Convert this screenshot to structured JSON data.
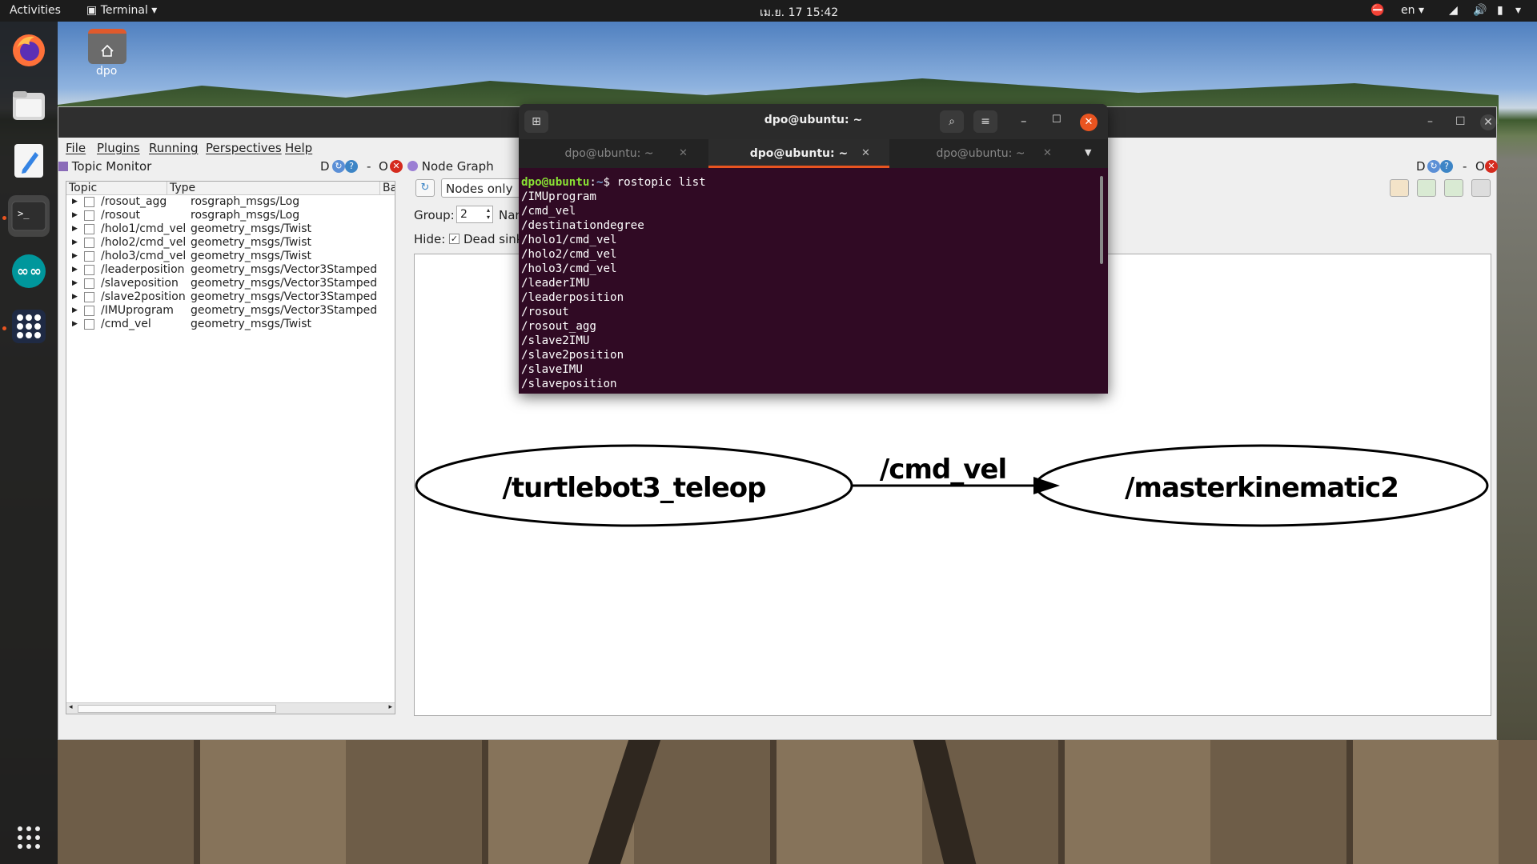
{
  "topbar": {
    "activities": "Activities",
    "app": "Terminal",
    "clock": "เม.ย. 17  15:42",
    "lang": "en"
  },
  "dock": {
    "icons": [
      "firefox-icon",
      "files-icon",
      "text-editor-icon",
      "terminal-icon",
      "arduino-icon",
      "app-grid-icon",
      "show-apps-icon"
    ]
  },
  "desktop": {
    "home_label": "dpo"
  },
  "rqt": {
    "menu": {
      "file": "File",
      "plugins": "Plugins",
      "running": "Running",
      "perspectives": "Perspectives",
      "help": "Help"
    },
    "topic_monitor": {
      "title": "Topic Monitor",
      "header_icons": [
        "D",
        "-",
        "O"
      ],
      "columns": [
        "Topic",
        "Type",
        "Ba"
      ],
      "rows": [
        {
          "topic": "/rosout_agg",
          "type": "rosgraph_msgs/Log"
        },
        {
          "topic": "/rosout",
          "type": "rosgraph_msgs/Log"
        },
        {
          "topic": "/holo1/cmd_vel",
          "type": "geometry_msgs/Twist"
        },
        {
          "topic": "/holo2/cmd_vel",
          "type": "geometry_msgs/Twist"
        },
        {
          "topic": "/holo3/cmd_vel",
          "type": "geometry_msgs/Twist"
        },
        {
          "topic": "/leaderposition",
          "type": "geometry_msgs/Vector3Stamped"
        },
        {
          "topic": "/slaveposition",
          "type": "geometry_msgs/Vector3Stamped"
        },
        {
          "topic": "/slave2position",
          "type": "geometry_msgs/Vector3Stamped"
        },
        {
          "topic": "/IMUprogram",
          "type": "geometry_msgs/Vector3Stamped"
        },
        {
          "topic": "/cmd_vel",
          "type": "geometry_msgs/Twist"
        }
      ]
    },
    "node_graph": {
      "title": "Node Graph",
      "header_icons": [
        "D",
        "-",
        "O"
      ],
      "mode": "Nodes only",
      "group_label": "Group:",
      "group_value": "2",
      "name_label": "Nan",
      "hide_label": "Hide:",
      "dead_sinks_label": "Dead sinks",
      "dead_sinks_checked": true,
      "graph": {
        "source": "/turtlebot3_teleop",
        "edge": "/cmd_vel",
        "target": "/masterkinematic2"
      }
    }
  },
  "terminal": {
    "title": "dpo@ubuntu: ~",
    "tabs": [
      "dpo@ubuntu: ~",
      "dpo@ubuntu: ~",
      "dpo@ubuntu: ~"
    ],
    "active_tab": 1,
    "prompt_user": "dpo@ubuntu",
    "prompt_sep": ":",
    "prompt_path": "~",
    "prompt_end": "$ ",
    "command": "rostopic list",
    "output": [
      "/IMUprogram",
      "/cmd_vel",
      "/destinationdegree",
      "/holo1/cmd_vel",
      "/holo2/cmd_vel",
      "/holo3/cmd_vel",
      "/leaderIMU",
      "/leaderposition",
      "/rosout",
      "/rosout_agg",
      "/slave2IMU",
      "/slave2position",
      "/slaveIMU",
      "/slaveposition"
    ]
  }
}
